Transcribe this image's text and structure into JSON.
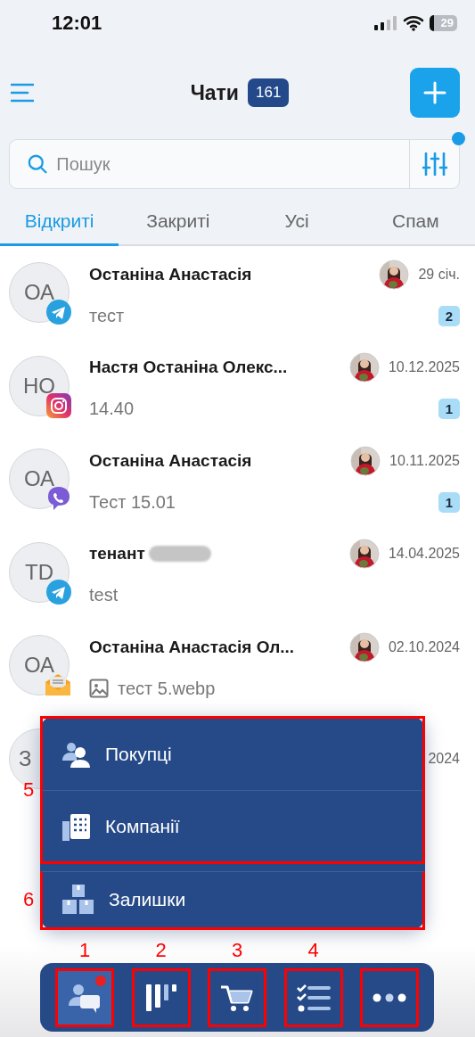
{
  "status_bar": {
    "time": "12:01",
    "battery": "29"
  },
  "header": {
    "title": "Чати",
    "count": "161"
  },
  "search": {
    "placeholder": "Пошук",
    "filter_active": true
  },
  "tabs": [
    {
      "label": "Відкриті",
      "selected": true
    },
    {
      "label": "Закриті",
      "selected": false
    },
    {
      "label": "Усі",
      "selected": false
    },
    {
      "label": "Спам",
      "selected": false
    }
  ],
  "chats": [
    {
      "initials": "ОА",
      "kind": "telegram",
      "name": "Останіна Анастасія",
      "agent_photo": true,
      "date": "29 січ.",
      "preview": "тест",
      "unread": "2"
    },
    {
      "initials": "НО",
      "kind": "instagram",
      "name": "Настя Останіна Олекс...",
      "agent_photo": true,
      "date": "10.12.2025",
      "preview": "14.40",
      "unread": "1"
    },
    {
      "initials": "ОА",
      "kind": "viber",
      "name": "Останіна Анастасія",
      "agent_photo": true,
      "date": "10.11.2025",
      "preview": "Тест 15.01",
      "unread": "1"
    },
    {
      "initials": "TD",
      "kind": "telegram",
      "name": "тенант",
      "name_redacted": true,
      "agent_photo": true,
      "date": "14.04.2025",
      "preview": "test"
    },
    {
      "initials": "ОА",
      "kind": "email",
      "name": "Останіна Анастасія Ол...",
      "agent_photo": true,
      "date": "02.10.2024",
      "preview": "тест 5.webp",
      "has_image": true
    },
    {
      "initials": "З",
      "date": "2024"
    }
  ],
  "menu": {
    "groups": [
      {
        "annotation": "5",
        "items": [
          {
            "label": "Покупці"
          },
          {
            "label": "Компанії"
          }
        ]
      },
      {
        "annotation": "6",
        "items": [
          {
            "label": "Залишки"
          }
        ]
      }
    ]
  },
  "bottom_nav": [
    {
      "selected": true,
      "badge": true,
      "annotation": "1"
    },
    {
      "selected": false,
      "annotation": "2"
    },
    {
      "selected": false,
      "annotation": "3"
    },
    {
      "selected": false,
      "annotation": "4"
    },
    {
      "selected": false
    }
  ]
}
